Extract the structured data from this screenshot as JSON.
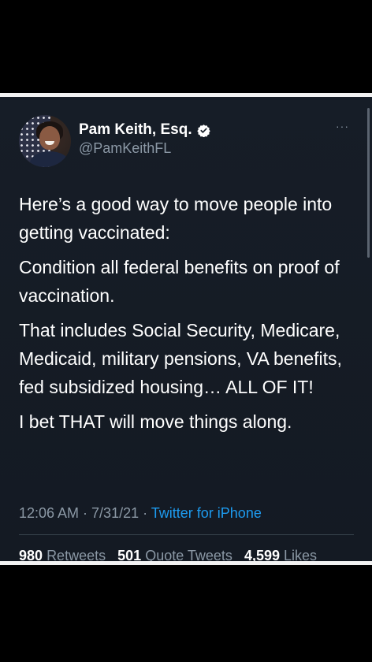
{
  "tweet": {
    "author": {
      "display_name": "Pam Keith, Esq.",
      "handle": "@PamKeithFL",
      "verified": true
    },
    "more_menu_label": "···",
    "paragraphs": [
      "Here’s a good way to move people into getting vaccinated:",
      "Condition all federal benefits on proof of vaccination.",
      "That includes Social Security, Medicare, Medicaid, military pensions, VA benefits, fed subsidized housing… ALL OF IT!",
      "I bet THAT will move things along."
    ],
    "timestamp": "12:06 AM · 7/31/21 · ",
    "source": "Twitter for iPhone",
    "stats": {
      "retweets_count": "980",
      "retweets_label": "Retweets",
      "quote_tweets_count": "501",
      "quote_tweets_label": "Quote Tweets",
      "likes_count": "4,599",
      "likes_label": "Likes"
    }
  },
  "colors": {
    "background": "#000000",
    "card": "#161d27",
    "text_primary": "#ffffff",
    "text_secondary": "#8b98a5",
    "link": "#1d9bf0",
    "verified_badge": "#ffffff"
  },
  "icons": [
    "avatar",
    "verified-badge-icon",
    "more-options-icon"
  ]
}
